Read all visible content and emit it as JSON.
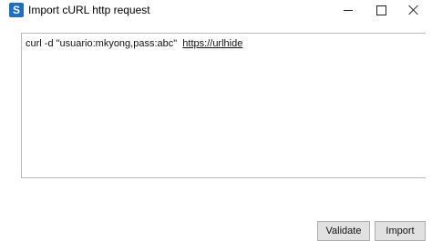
{
  "window": {
    "title": "Import cURL http request",
    "icon": "app-logo-icon",
    "controls": {
      "minimize": "minimize-icon",
      "maximize": "maximize-icon",
      "close": "close-icon"
    }
  },
  "editor": {
    "command": "curl -d \"usuario:mkyong,pass:abc\"",
    "url": "https://urlhide"
  },
  "buttons": {
    "validate": "Validate",
    "import": "Import"
  },
  "colors": {
    "icon_accent": "#1f6fbf",
    "button_bg": "#e1e1e1"
  }
}
